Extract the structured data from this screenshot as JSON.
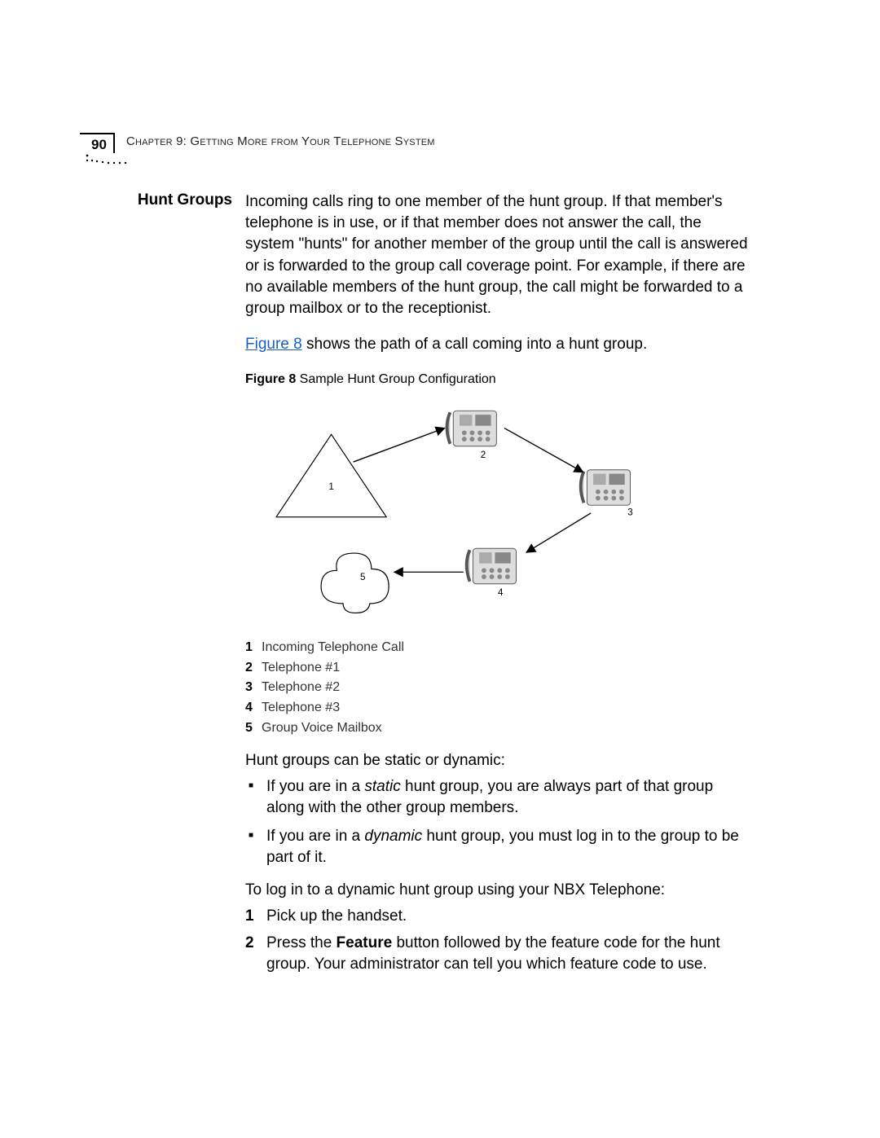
{
  "pageNumber": "90",
  "chapterHeader": "Chapter 9: Getting More from Your Telephone System",
  "sidebarTitle": "Hunt Groups",
  "para1": "Incoming calls ring to one member of the hunt group. If that member's telephone is in use, or if that member does not answer the call, the system \"hunts\" for another member of the group until the call is answered or is forwarded to the group call coverage point. For example, if there are no available members of the hunt group, the call might be forwarded to a group mailbox or to the receptionist.",
  "figureRefLink": "Figure 8",
  "figureRefRest": " shows the path of a call coming into a hunt group.",
  "figureLabelBold": "Figure 8",
  "figureLabelRest": "   Sample Hunt Group Configuration",
  "diagramNodes": {
    "1": "1",
    "2": "2",
    "3": "3",
    "4": "4",
    "5": "5"
  },
  "legend": [
    {
      "n": "1",
      "t": "Incoming Telephone Call"
    },
    {
      "n": "2",
      "t": "Telephone #1"
    },
    {
      "n": "3",
      "t": "Telephone #2"
    },
    {
      "n": "4",
      "t": "Telephone #3"
    },
    {
      "n": "5",
      "t": "Group Voice Mailbox"
    }
  ],
  "para2": "Hunt groups can be static or dynamic:",
  "bullet1_pre": "If you are in a ",
  "bullet1_em": "static",
  "bullet1_post": " hunt group, you are always part of that group along with the other group members.",
  "bullet2_pre": "If you are in a ",
  "bullet2_em": "dynamic",
  "bullet2_post": " hunt group, you must log in to the group to be part of it.",
  "para3": "To log in to a dynamic hunt group using your NBX Telephone:",
  "step1_n": "1",
  "step1_t": "Pick up the handset.",
  "step2_n": "2",
  "step2_pre": "Press the ",
  "step2_bold": "Feature",
  "step2_post": " button followed by the feature code for the hunt group. Your administrator can tell you which feature code to use."
}
